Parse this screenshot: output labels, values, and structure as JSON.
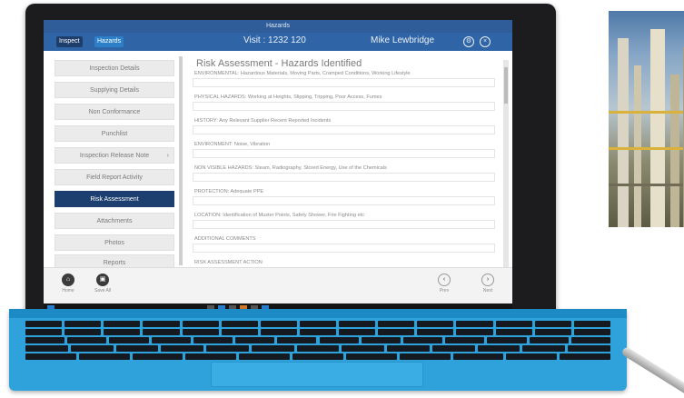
{
  "app": {
    "title": "Hazards",
    "header": {
      "chip_a": "Inspect",
      "chip_b": "Hazards",
      "visit": "Visit : 1232 120",
      "user": "Mike Lewbridge"
    }
  },
  "sidebar": {
    "items": [
      {
        "label": "Inspection Details",
        "active": false
      },
      {
        "label": "Supplying Details",
        "active": false
      },
      {
        "label": "Non Conformance",
        "active": false
      },
      {
        "label": "Punchlist",
        "active": false
      },
      {
        "label": "Inspection Release Note",
        "active": false,
        "has_arrow": true
      },
      {
        "label": "Field Report Activity",
        "active": false
      },
      {
        "label": "Risk Assessment",
        "active": true
      },
      {
        "label": "Attachments",
        "active": false
      },
      {
        "label": "Photos",
        "active": false
      },
      {
        "label": "Reports",
        "active": false
      }
    ]
  },
  "main": {
    "title": "Risk Assessment - Hazards Identified",
    "rows": [
      {
        "label": "ENVIRONMENTAL: Hazardous Materials, Moving Parts, Cramped Conditions, Working Lifestyle"
      },
      {
        "label": "PHYSICAL HAZARDS: Working at Heights, Slipping, Tripping, Poor Access, Fumes"
      },
      {
        "label": "HISTORY: Any Relevant Supplier Recent Reported Incidents"
      },
      {
        "label": "ENVIRONMENT: Noise, Vibration"
      },
      {
        "label": "NON VISIBLE HAZARDS: Steam, Radiography, Stored Energy, Use of the Chemicals"
      },
      {
        "label": "PROTECTION: Adequate PPE"
      },
      {
        "label": "LOCATION: Identification of Muster Points, Safety Shower, Fire Fighting etc"
      },
      {
        "label": "ADDITIONAL COMMENTS"
      },
      {
        "label": "RISK ASSESSMENT ACTION"
      }
    ]
  },
  "bottom": {
    "left": [
      {
        "label": "Home",
        "icon": "home-icon"
      },
      {
        "label": "Save All",
        "icon": "save-icon"
      }
    ],
    "right": [
      {
        "label": "Prev",
        "icon": "prev-icon"
      },
      {
        "label": "Next",
        "icon": "next-icon"
      }
    ]
  },
  "colors": {
    "header": "#2f64a6",
    "active_item": "#1d3f6f",
    "keyboard": "#2fa2dc"
  }
}
